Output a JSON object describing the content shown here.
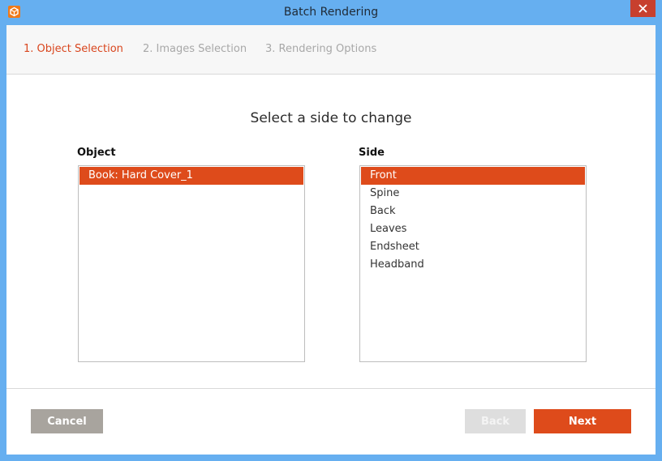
{
  "window": {
    "title": "Batch Rendering",
    "accent_color": "#de4b1b",
    "titlebar_color": "#66aff0"
  },
  "steps": [
    {
      "label": "1. Object Selection",
      "active": true
    },
    {
      "label": "2. Images Selection",
      "active": false
    },
    {
      "label": "3. Rendering Options",
      "active": false
    }
  ],
  "main": {
    "heading": "Select a side to change",
    "object_label": "Object",
    "side_label": "Side",
    "objects": [
      "Book: Hard Cover_1"
    ],
    "selected_object": "Book: Hard Cover_1",
    "sides": [
      "Front",
      "Spine",
      "Back",
      "Leaves",
      "Endsheet",
      "Headband"
    ],
    "selected_side": "Front"
  },
  "footer": {
    "cancel_label": "Cancel",
    "back_label": "Back",
    "next_label": "Next",
    "back_enabled": false
  }
}
